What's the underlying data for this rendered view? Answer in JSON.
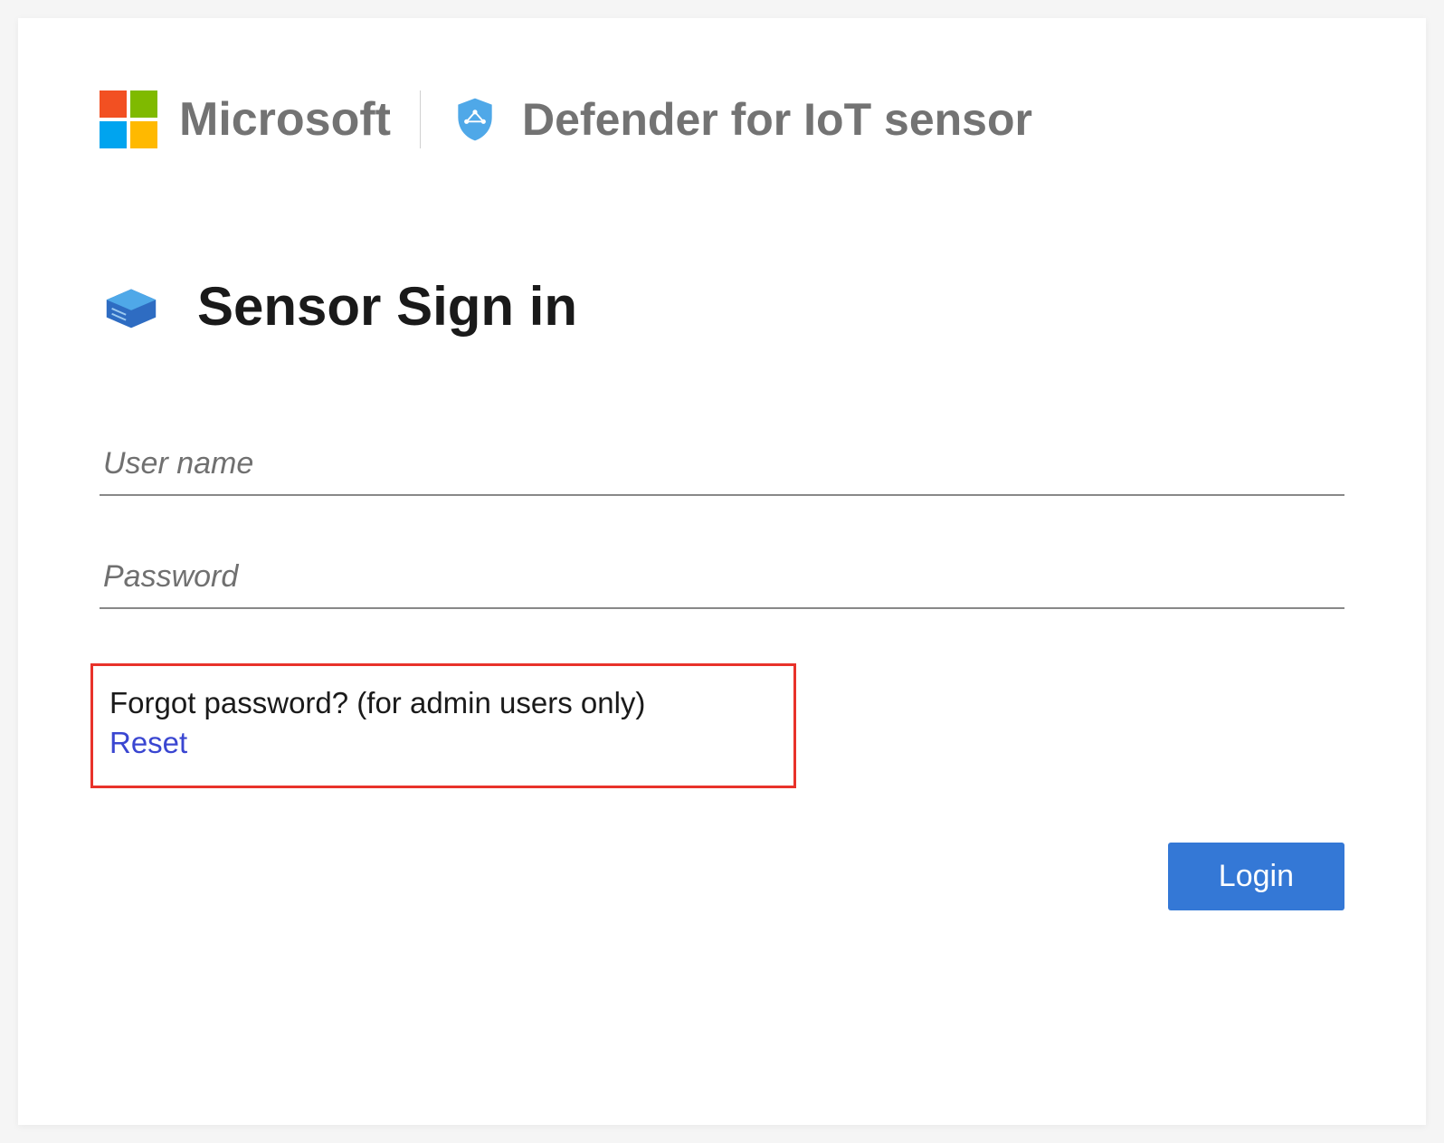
{
  "header": {
    "vendor": "Microsoft",
    "product": "Defender for IoT sensor"
  },
  "signin": {
    "title": "Sensor Sign in",
    "username_placeholder": "User name",
    "password_placeholder": "Password"
  },
  "forgot": {
    "text": "Forgot password? (for admin users only)",
    "link": "Reset"
  },
  "buttons": {
    "login": "Login"
  }
}
